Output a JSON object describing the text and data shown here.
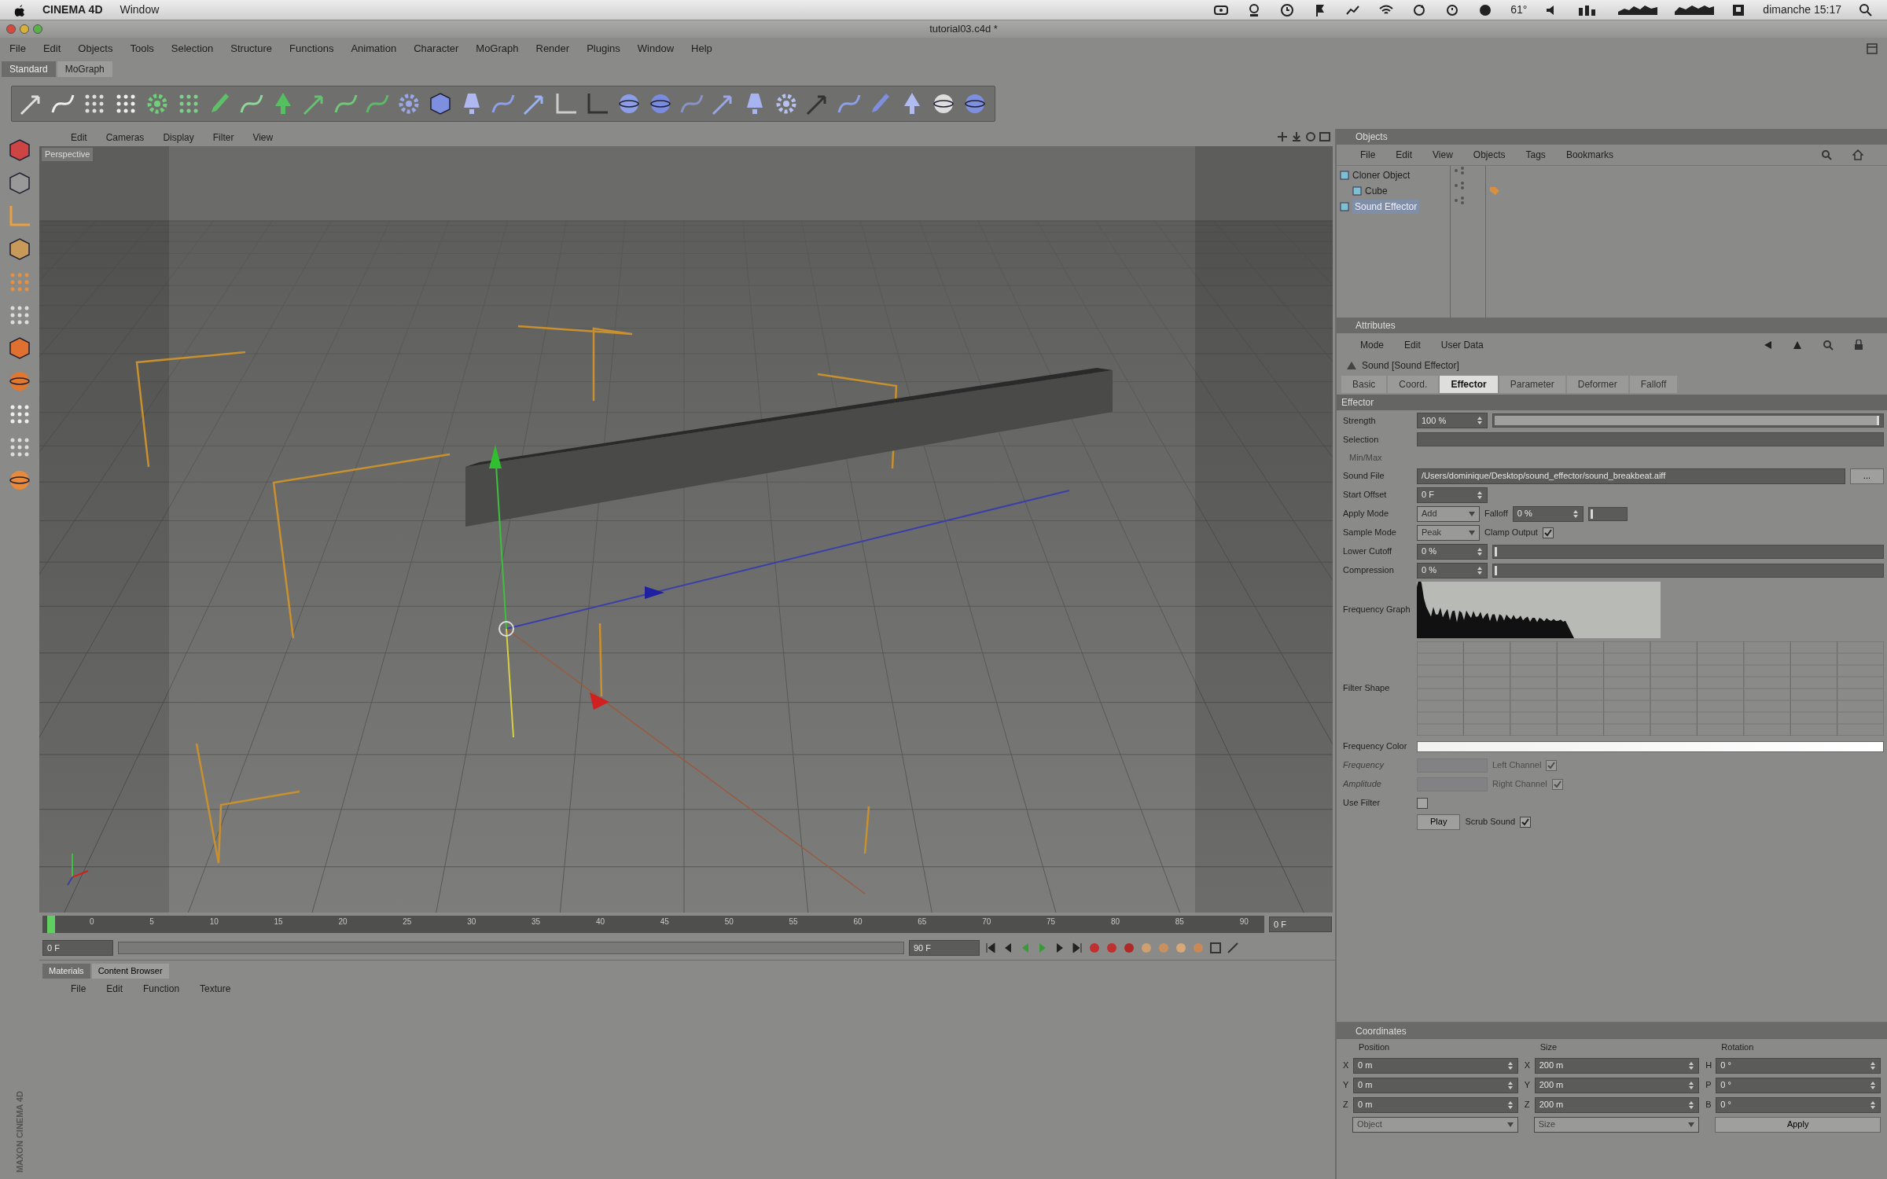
{
  "menubar": {
    "app": "CINEMA 4D",
    "items": [
      "Window"
    ],
    "temperature": "61°",
    "clock": "dimanche 15:17"
  },
  "window": {
    "title": "tutorial03.c4d *"
  },
  "menu": [
    "File",
    "Edit",
    "Objects",
    "Tools",
    "Selection",
    "Structure",
    "Functions",
    "Animation",
    "Character",
    "MoGraph",
    "Render",
    "Plugins",
    "Window",
    "Help"
  ],
  "layouts": [
    {
      "label": "Standard",
      "selected": true
    },
    {
      "label": "MoGraph",
      "selected": false
    }
  ],
  "viewport": {
    "menu": [
      "Edit",
      "Cameras",
      "Display",
      "Filter",
      "View"
    ],
    "label": "Perspective"
  },
  "timeline": {
    "ticks": [
      "0",
      "5",
      "10",
      "15",
      "20",
      "25",
      "30",
      "35",
      "40",
      "45",
      "50",
      "55",
      "60",
      "65",
      "70",
      "75",
      "80",
      "85",
      "90"
    ],
    "current_frame": "0 F",
    "start_field": "0 F",
    "end_field": "90 F"
  },
  "materials": {
    "tabs": [
      {
        "label": "Materials",
        "selected": true
      },
      {
        "label": "Content Browser",
        "selected": false
      }
    ],
    "menu": [
      "File",
      "Edit",
      "Function",
      "Texture"
    ]
  },
  "objects": {
    "title": "Objects",
    "menu": [
      "File",
      "Edit",
      "View",
      "Objects",
      "Tags",
      "Bookmarks"
    ],
    "tree": [
      {
        "name": "Cloner Object",
        "selected": false,
        "children": [
          {
            "name": "Cube",
            "selected": false
          }
        ]
      },
      {
        "name": "Sound Effector",
        "selected": true
      }
    ]
  },
  "attributes": {
    "title": "Attributes",
    "menu": [
      "Mode",
      "Edit",
      "User Data"
    ],
    "object": "Sound [Sound Effector]",
    "tabs": [
      {
        "label": "Basic",
        "selected": false
      },
      {
        "label": "Coord.",
        "selected": false
      },
      {
        "label": "Effector",
        "selected": true
      },
      {
        "label": "Parameter",
        "selected": false
      },
      {
        "label": "Deformer",
        "selected": false
      },
      {
        "label": "Falloff",
        "selected": false
      }
    ],
    "section": "Effector",
    "rows": [
      {
        "kind": "param",
        "label": "Strength",
        "disabled": false,
        "controls": [
          {
            "kind": "slider",
            "value": "100 %",
            "level": 1
          }
        ]
      },
      {
        "kind": "param",
        "label": "Selection",
        "disabled": false,
        "controls": [
          {
            "kind": "link"
          }
        ]
      },
      {
        "kind": "group",
        "label": "Min/Max"
      },
      {
        "kind": "param",
        "label": "Sound File",
        "disabled": false,
        "controls": [
          {
            "kind": "file",
            "value": "/Users/dominique/Desktop/sound_effector/sound_breakbeat.aiff",
            "button": "..."
          }
        ]
      },
      {
        "kind": "param",
        "label": "Start Offset",
        "disabled": false,
        "controls": [
          {
            "kind": "number",
            "value": "0 F"
          }
        ]
      },
      {
        "kind": "param",
        "label": "Apply Mode",
        "disabled": false,
        "controls": [
          {
            "kind": "dropdown",
            "value": "Add"
          },
          {
            "kind": "short_slider",
            "label": "Falloff",
            "value": "0 %",
            "level": 0
          }
        ]
      },
      {
        "kind": "param",
        "label": "Sample Mode",
        "disabled": false,
        "controls": [
          {
            "kind": "dropdown",
            "value": "Peak"
          },
          {
            "kind": "checkbox",
            "label": "Clamp Output",
            "checked": true
          }
        ]
      },
      {
        "kind": "param",
        "label": "Lower Cutoff",
        "disabled": false,
        "controls": [
          {
            "kind": "slider",
            "value": "0 %",
            "level": 0
          }
        ]
      },
      {
        "kind": "param",
        "label": "Compression",
        "disabled": false,
        "controls": [
          {
            "kind": "slider",
            "value": "0 %",
            "level": 0
          }
        ]
      },
      {
        "kind": "param",
        "label": "Frequency Graph",
        "disabled": false,
        "controls": [
          {
            "kind": "graph"
          }
        ]
      },
      {
        "kind": "param",
        "label": "Filter Shape",
        "disabled": false,
        "controls": [
          {
            "kind": "curve"
          }
        ]
      },
      {
        "kind": "param",
        "label": "Frequency Color",
        "disabled": false,
        "controls": [
          {
            "kind": "gradient"
          }
        ]
      },
      {
        "kind": "param",
        "label": "Frequency",
        "disabled": true,
        "controls": [
          {
            "kind": "swatch"
          },
          {
            "kind": "checkbox",
            "label": "Left Channel",
            "checked": true
          }
        ]
      },
      {
        "kind": "param",
        "label": "Amplitude",
        "disabled": true,
        "controls": [
          {
            "kind": "swatch"
          },
          {
            "kind": "checkbox",
            "label": "Right Channel",
            "checked": true
          }
        ]
      },
      {
        "kind": "param",
        "label": "Use Filter",
        "disabled": false,
        "controls": [
          {
            "kind": "checkbox",
            "checked": false
          }
        ]
      },
      {
        "kind": "param",
        "disabled": false,
        "controls": [
          {
            "kind": "button",
            "value": "Play"
          },
          {
            "kind": "checkbox",
            "label": "Scrub Sound",
            "checked": true
          }
        ]
      }
    ]
  },
  "coordinates": {
    "title": "Coordinates",
    "columns": [
      {
        "heading": "Position",
        "fields": [
          {
            "axis": "X",
            "value": "0 m"
          },
          {
            "axis": "Y",
            "value": "0 m"
          },
          {
            "axis": "Z",
            "value": "0 m"
          }
        ],
        "footer": {
          "kind": "dropdown",
          "value": "Object"
        }
      },
      {
        "heading": "Size",
        "fields": [
          {
            "axis": "X",
            "value": "200 m"
          },
          {
            "axis": "Y",
            "value": "200 m"
          },
          {
            "axis": "Z",
            "value": "200 m"
          }
        ],
        "footer": {
          "kind": "dropdown",
          "value": "Size"
        }
      },
      {
        "heading": "Rotation",
        "fields": [
          {
            "axis": "H",
            "value": "0 °"
          },
          {
            "axis": "P",
            "value": "0 °"
          },
          {
            "axis": "B",
            "value": "0 °"
          }
        ],
        "footer": {
          "kind": "button",
          "value": "Apply"
        }
      }
    ]
  },
  "logo": "MAXON CINEMA 4D"
}
